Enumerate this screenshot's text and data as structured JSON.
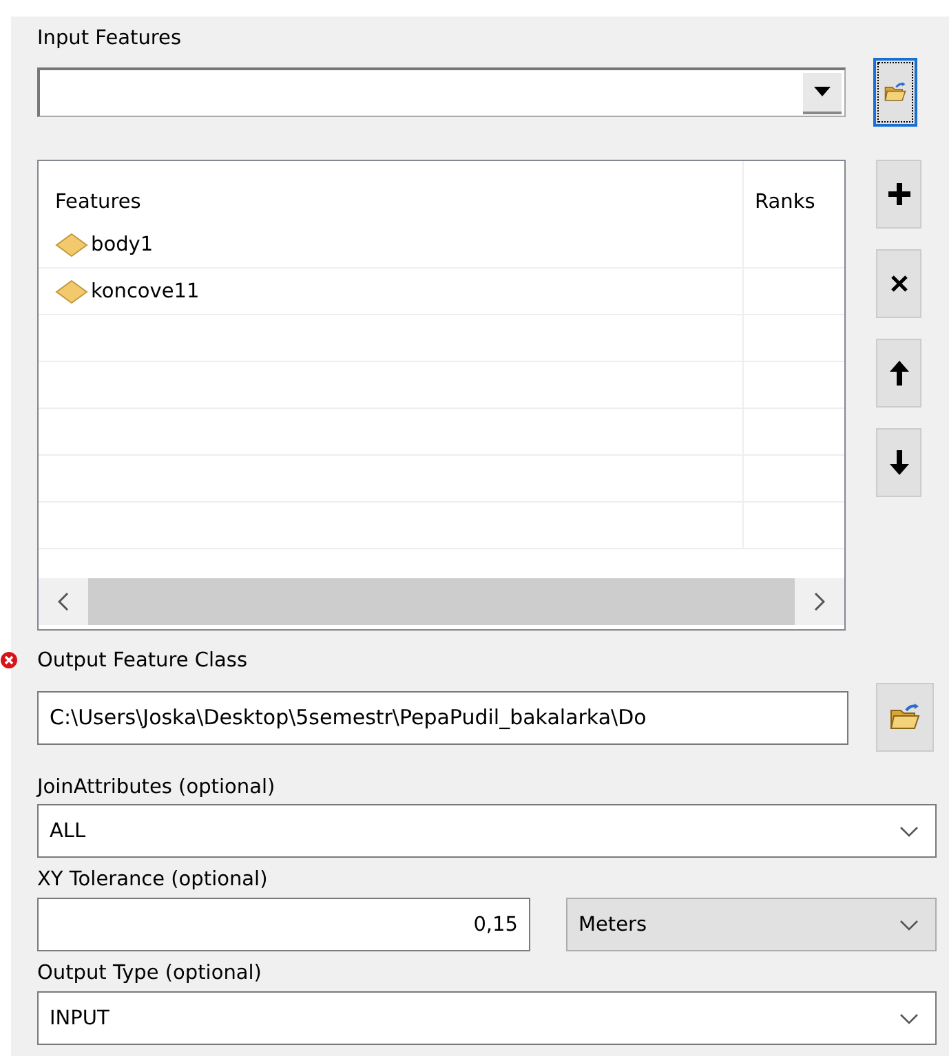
{
  "input_features": {
    "label": "Input Features"
  },
  "features_table": {
    "columns": [
      "Features",
      "Ranks"
    ],
    "rows": [
      {
        "name": "body1"
      },
      {
        "name": "koncove11"
      }
    ]
  },
  "list_buttons": [
    {
      "kind": "add"
    },
    {
      "kind": "remove"
    },
    {
      "kind": "up"
    },
    {
      "kind": "down"
    }
  ],
  "output_feature_class": {
    "label": "Output Feature Class",
    "value": "C:\\Users\\Joska\\Desktop\\5semestr\\PepaPudil_bakalarka\\Do",
    "error": true
  },
  "join_attributes": {
    "label": "JoinAttributes (optional)",
    "value": "ALL"
  },
  "xy_tolerance": {
    "label": "XY Tolerance (optional)",
    "value": "0,15",
    "units": "Meters"
  },
  "output_type": {
    "label": "Output Type (optional)",
    "value": "INPUT"
  }
}
